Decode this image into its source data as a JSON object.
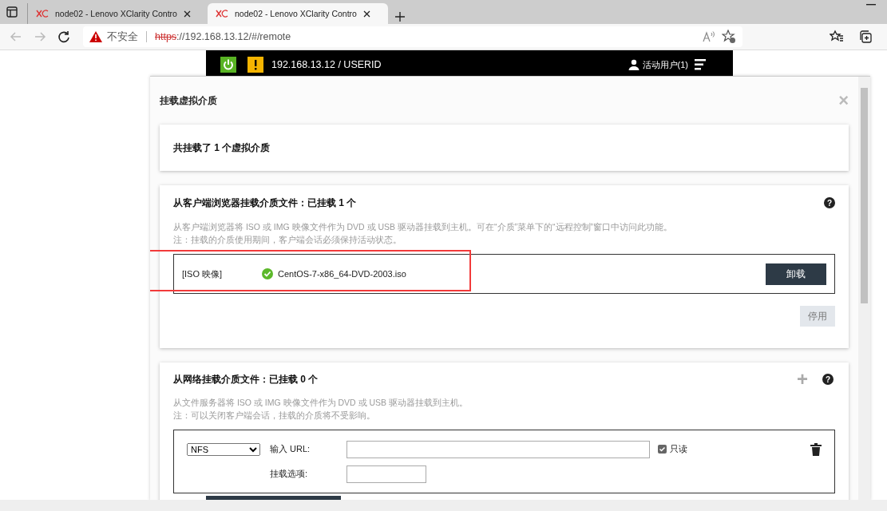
{
  "browser": {
    "tabs": [
      {
        "title": "node02 - Lenovo XClarity Contro",
        "selected": false
      },
      {
        "title": "node02 - Lenovo XClarity Contro",
        "selected": true
      }
    ],
    "security": "不安全",
    "url_scheme": "https",
    "url_rest": "://192.168.13.12/#/remote"
  },
  "header": {
    "host": "192.168.13.12 / USERID",
    "users": "活动用户(1)"
  },
  "modal": {
    "title": "挂载虚拟介质",
    "close": "×",
    "summary": "共挂载了 1 个虚拟介质",
    "client": {
      "title": "从客户端浏览器挂载介质文件：已挂载 1 个",
      "help": "?",
      "desc": "从客户端浏览器将 ISO 或 IMG 映像文件作为 DVD 或 USB 驱动器挂载到主机。可在“介质”菜单下的“远程控制”窗口中访问此功能。",
      "note": "注：挂载的介质使用期间，客户端会话必须保持活动状态。",
      "files": [
        {
          "type": "[ISO 映像]",
          "name": "CentOS-7-x86_64-DVD-2003.iso",
          "mounted": true,
          "action": "卸载"
        }
      ],
      "disable_button": {
        "label": "停用",
        "disabled": true
      }
    },
    "network": {
      "title": "从网络挂载介质文件：已挂载 0 个",
      "help": "?",
      "add": "+",
      "desc": "从文件服务器将 ISO 或 IMG 映像文件作为 DVD 或 USB 驱动器挂载到主机。",
      "note": "注：可以关闭客户端会话，挂载的介质将不受影响。",
      "protocol": "NFS",
      "url_label": "输入 URL:",
      "readonly": {
        "label": "只读",
        "checked": true
      },
      "options_label": "挂载选项:"
    }
  }
}
